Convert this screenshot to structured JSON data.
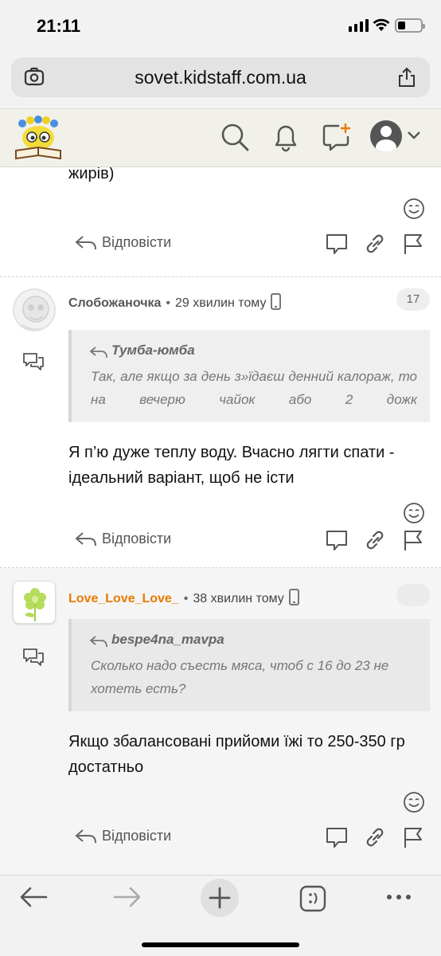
{
  "status_bar": {
    "time": "21:11"
  },
  "browser": {
    "url": "sovet.kidstaff.com.ua"
  },
  "comments_tail": {
    "text": "жирів)",
    "reply_label": "Відповісти"
  },
  "comments": [
    {
      "author": "Слобожаночка",
      "time": "29 хвилин тому",
      "badge": "17",
      "quote_author": "Тумба-юмба",
      "quote_text": "Так, але якщо за день з»їдаєш денний калораж, то на вечерю чайок або 2 дожк",
      "body": "Я п’ю дуже теплу воду. Вчасно лягти спати - ідеальний варіант, щоб не істи",
      "reply_label": "Відповісти"
    },
    {
      "author": "Love_Love_Love_",
      "time": "38 хвилин тому",
      "badge": "",
      "quote_author": "bespe4na_mavpa",
      "quote_text": "Сколько надо съесть мяса, чтоб с 16 до 23 не хотеть есть?",
      "body": "Якщо збалансовані прийоми їжі то 250-350 гр достатньо",
      "reply_label": "Відповісти"
    }
  ],
  "icons": {
    "header": [
      "search-icon",
      "bell-icon",
      "new-message-icon",
      "user-avatar-icon",
      "chevron-down-icon"
    ],
    "actions": [
      "reply-arrow-icon",
      "comment-icon",
      "link-icon",
      "flag-icon",
      "smile-icon"
    ],
    "toolbar": [
      "back-arrow-icon",
      "forward-arrow-icon",
      "plus-icon",
      "tabs-icon",
      "more-icon"
    ]
  },
  "colors": {
    "accent_orange": "#e87b00",
    "header_bg": "#f1f1ea",
    "alt_post_bg": "#f5f5f5"
  }
}
